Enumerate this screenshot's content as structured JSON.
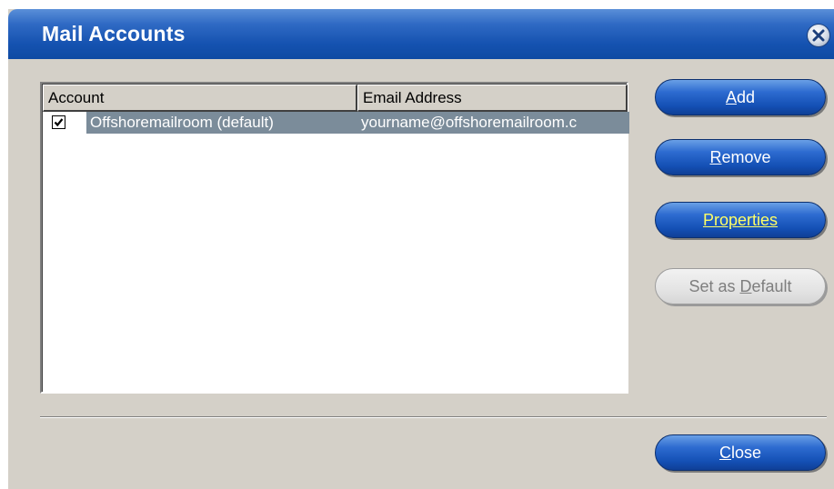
{
  "window": {
    "title": "Mail Accounts"
  },
  "list": {
    "columns": [
      "Account",
      "Email Address"
    ],
    "rows": [
      {
        "checked": true,
        "account": "Offshoremailroom (default)",
        "email": "yourname@offshoremailroom.c",
        "selected": true
      }
    ]
  },
  "buttons": {
    "add": {
      "label": "dd",
      "mnemonic": "A",
      "enabled": true
    },
    "remove": {
      "label": "emove",
      "mnemonic": "R",
      "enabled": true
    },
    "properties": {
      "label": "Properties",
      "enabled": true,
      "highlighted": true
    },
    "set_default": {
      "prefix": "Set as ",
      "mnemonic": "D",
      "suffix": "efault",
      "enabled": false
    },
    "close": {
      "label": "lose",
      "mnemonic": "C",
      "enabled": true
    }
  },
  "colors": {
    "title_bar": "#1552b0",
    "dialog_bg": "#d4d0c8",
    "selection": "#7b8c9a",
    "highlight_text": "#ffff66"
  },
  "icons": {
    "close": "close-x-icon",
    "checkbox": "checkmark-icon"
  }
}
